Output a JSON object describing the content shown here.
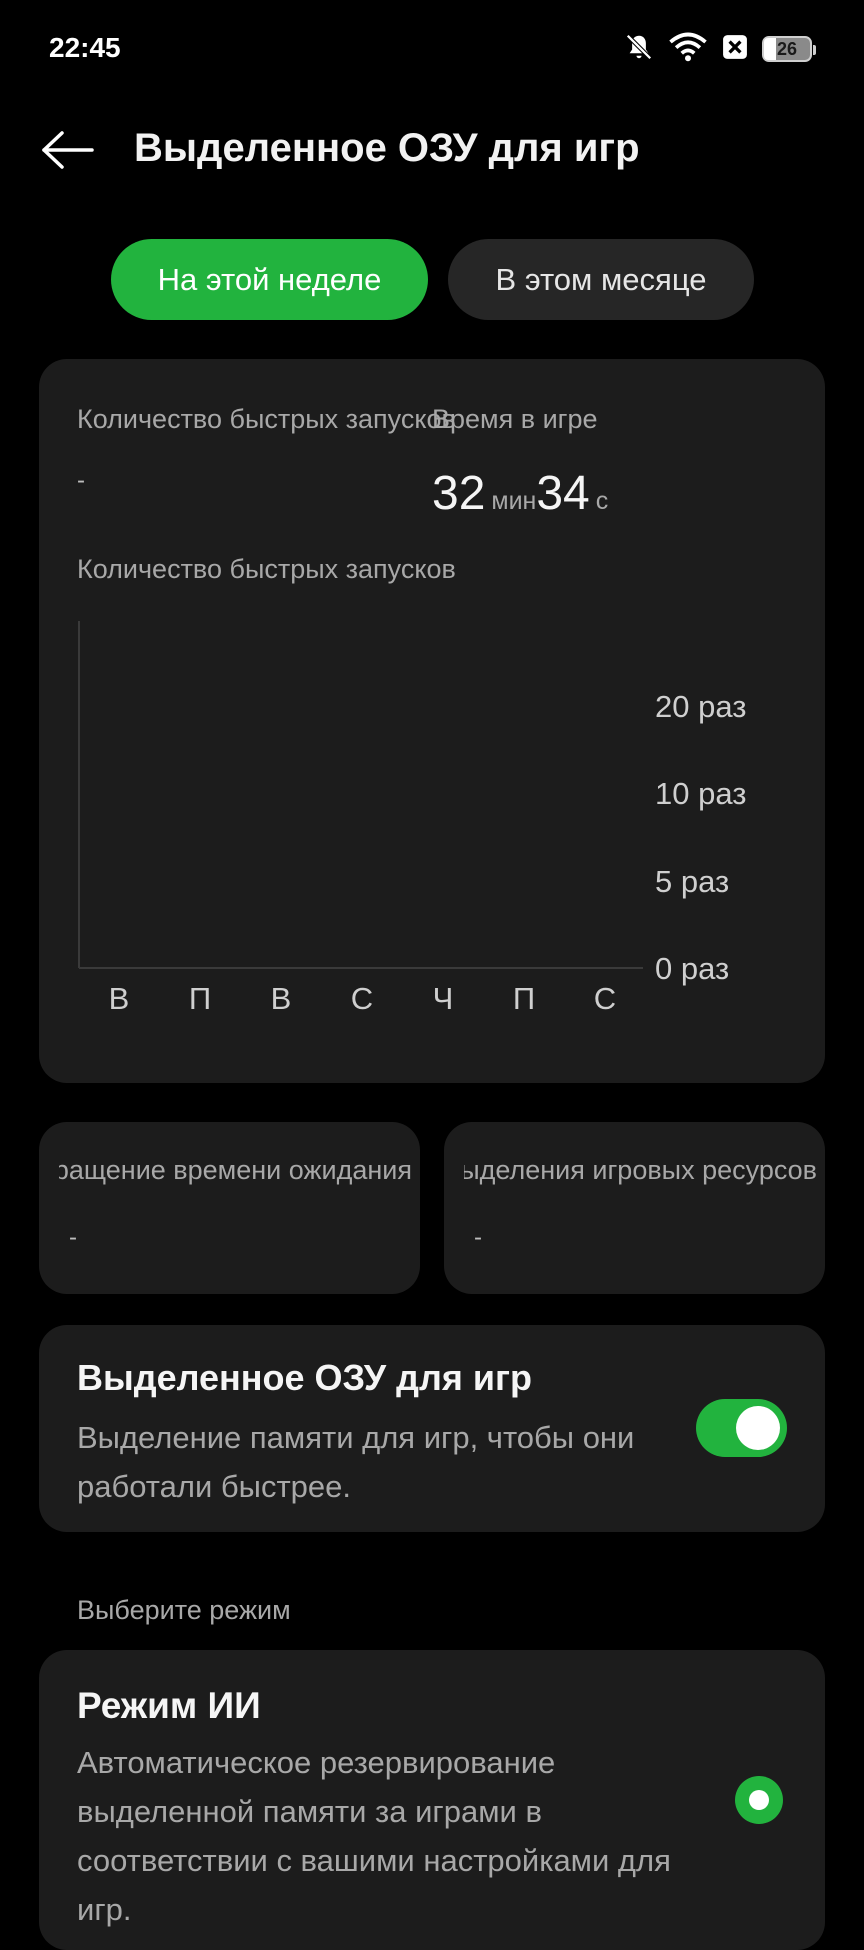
{
  "status_bar": {
    "time": "22:45",
    "battery_level": "26",
    "icons": [
      "bell-off-icon",
      "wifi-icon",
      "x-box-icon",
      "battery-icon"
    ]
  },
  "header": {
    "title": "Выделенное ОЗУ для игр",
    "back_icon": "arrow-left-icon"
  },
  "tabs": [
    {
      "label": "На этой неделе",
      "active": true
    },
    {
      "label": "В этом месяце",
      "active": false
    }
  ],
  "stats": {
    "launches_label": "Количество быстрых запусков",
    "launches_value": "-",
    "time_label": "Время в игре",
    "time_minutes": "32",
    "time_minutes_unit": "мин",
    "time_seconds": "34",
    "time_seconds_unit": "с"
  },
  "chart_data": {
    "type": "bar",
    "title": "Количество быстрых запусков",
    "categories": [
      "В",
      "П",
      "В",
      "С",
      "Ч",
      "П",
      "С"
    ],
    "values": [
      0,
      0,
      0,
      0,
      0,
      0,
      0
    ],
    "y_ticks": [
      {
        "value": 0,
        "label": "0 раз"
      },
      {
        "value": 5,
        "label": "5 раз"
      },
      {
        "value": 10,
        "label": "10 раз"
      },
      {
        "value": 20,
        "label": "20 раз"
      }
    ],
    "y_axis_side": "right",
    "grid": false
  },
  "metrics": [
    {
      "label": "Сокращение времени ожидания",
      "value": "-"
    },
    {
      "label": "Выделения игровых ресурсов",
      "value": "-"
    }
  ],
  "toggle_card": {
    "title": "Выделенное ОЗУ для игр",
    "description": "Выделение памяти для игр, чтобы они работали быстрее.",
    "enabled": true
  },
  "mode_section": {
    "header": "Выберите режим",
    "modes": [
      {
        "title": "Режим ИИ",
        "description": "Автоматическое резервирование выделенной памяти за играми в соответствии с вашими настройками для игр.",
        "selected": true
      }
    ]
  },
  "colors": {
    "accent": "#22b33e",
    "background": "#000000",
    "card": "#1c1c1c"
  }
}
